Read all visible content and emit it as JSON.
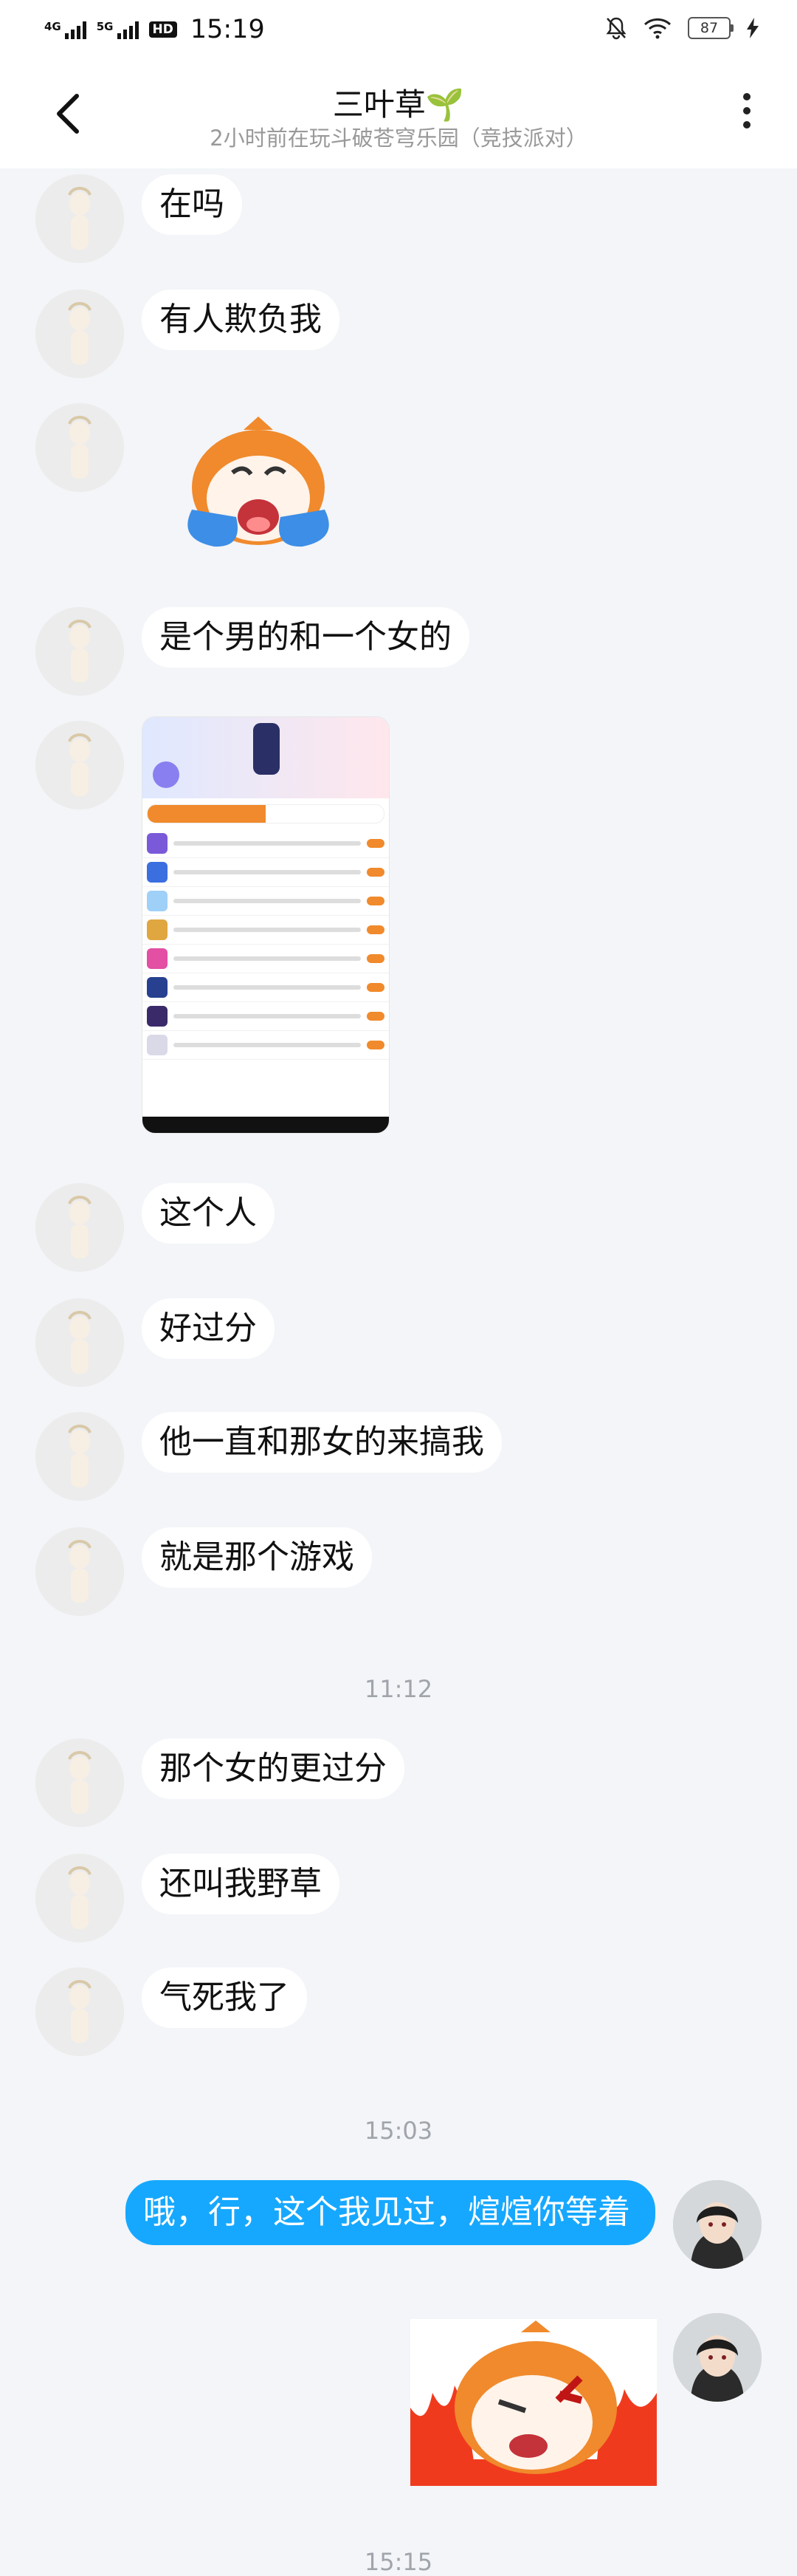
{
  "status_bar": {
    "network1": "4G",
    "network2": "5G",
    "hd": "HD",
    "time": "15:19",
    "battery": "87"
  },
  "header": {
    "title": "三叶草🌱",
    "subtitle": "2小时前在玩斗破苍穹乐园（竞技派对）"
  },
  "messages": [
    {
      "text": "在吗"
    },
    {
      "text": "有人欺负我"
    },
    {
      "text": "是个男的和一个女的"
    },
    {
      "text": "这个人"
    },
    {
      "text": "好过分"
    },
    {
      "text": "他一直和那女的来搞我"
    },
    {
      "text": "就是那个游戏"
    },
    {
      "text": "那个女的更过分"
    },
    {
      "text": "还叫我野草"
    },
    {
      "text": "气死我了"
    }
  ],
  "timestamps": [
    "11:12",
    "15:03",
    "15:15"
  ],
  "my_message": {
    "text": "哦，行，这个我见过，煊煊你等着"
  },
  "icons": {
    "back": "chevron-left-icon",
    "more": "more-vertical-icon",
    "wifi": "wifi-icon",
    "mute": "bell-off-icon",
    "charging": "bolt-icon"
  },
  "colors": {
    "my_bubble": "#16a8ff",
    "background": "#f3f5f8",
    "sticker_orange": "#f08a2c"
  }
}
